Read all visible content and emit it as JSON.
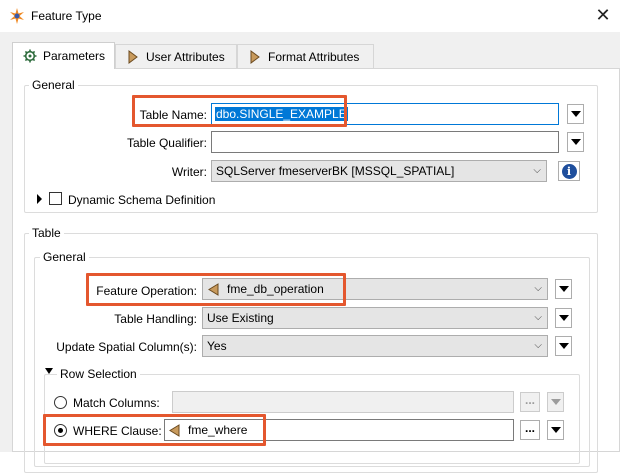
{
  "window": {
    "title": "Feature Type",
    "close_icon": "close-icon"
  },
  "tabs": [
    {
      "label": "Parameters",
      "icon": "gear-icon",
      "active": true
    },
    {
      "label": "User Attributes",
      "icon": "attribute-arrow-icon",
      "active": false
    },
    {
      "label": "Format Attributes",
      "icon": "attribute-arrow-icon",
      "active": false
    }
  ],
  "general": {
    "title": "General",
    "table_name": {
      "label": "Table Name:",
      "value": "dbo.SINGLE_EXAMPLE"
    },
    "table_qualifier": {
      "label": "Table Qualifier:",
      "value": ""
    },
    "writer": {
      "label": "Writer:",
      "value": "SQLServer fmeserverBK [MSSQL_SPATIAL]"
    },
    "dynamic_schema": {
      "label": "Dynamic Schema Definition",
      "checked": false
    }
  },
  "table": {
    "title": "Table",
    "general_title": "General",
    "feature_operation": {
      "label": "Feature Operation:",
      "value": "fme_db_operation"
    },
    "table_handling": {
      "label": "Table Handling:",
      "value": "Use Existing"
    },
    "update_spatial": {
      "label": "Update Spatial Column(s):",
      "value": "Yes"
    },
    "row_selection": {
      "title": "Row Selection",
      "match_columns": {
        "label": "Match Columns:",
        "selected": false,
        "value": ""
      },
      "where_clause": {
        "label": "WHERE Clause:",
        "selected": true,
        "value": "fme_where"
      }
    }
  },
  "colors": {
    "highlight": "#e4572e",
    "selection": "#0078d7",
    "info": "#1e4e9c",
    "attribute_icon": "#c89a5c"
  }
}
